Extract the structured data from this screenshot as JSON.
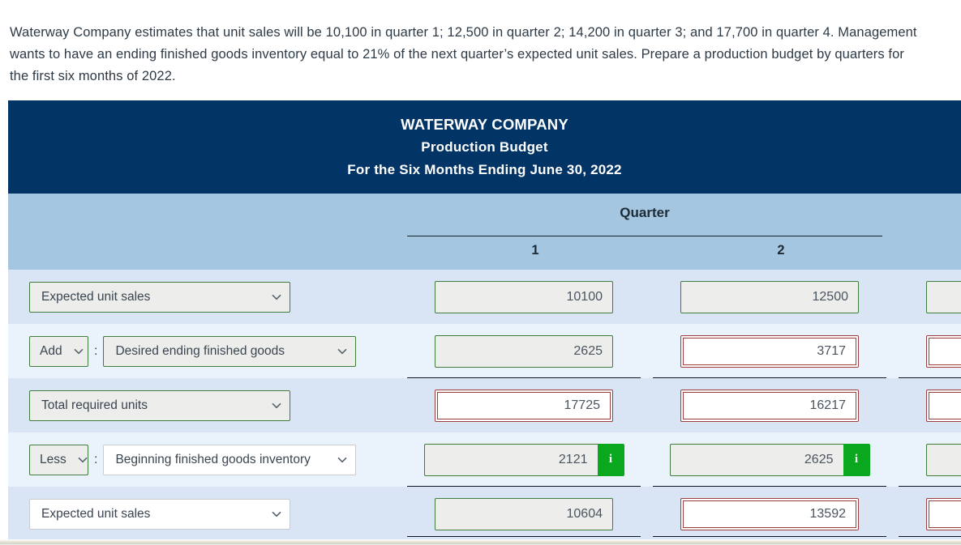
{
  "problem": {
    "text": "Waterway Company estimates that unit sales will be 10,100 in quarter 1; 12,500 in quarter 2; 14,200 in quarter 3; and 17,700 in quarter 4. Management wants to have an ending finished goods inventory equal to 21% of the next quarter’s expected unit sales. Prepare a production budget by quarters for the first six months of 2022."
  },
  "statement_header": {
    "company": "WATERWAY COMPANY",
    "report": "Production Budget",
    "period": "For the Six Months Ending June 30, 2022"
  },
  "column_group": {
    "label": "Quarter",
    "columns": [
      "1",
      "2"
    ]
  },
  "rows": [
    {
      "prefix": null,
      "prefix_colon": null,
      "account": "Expected unit sales",
      "account_style": "filled",
      "values": [
        {
          "value": "10100",
          "state": "filled",
          "info": false
        },
        {
          "value": "12500",
          "state": "filled",
          "info": false
        },
        {
          "value": "",
          "state": "filled",
          "info": false
        }
      ],
      "rule": "none"
    },
    {
      "prefix": "Add",
      "prefix_colon": ":",
      "account": "Desired ending finished goods",
      "account_style": "filled",
      "values": [
        {
          "value": "2625",
          "state": "filled",
          "info": false
        },
        {
          "value": "3717",
          "state": "wrong",
          "info": false
        },
        {
          "value": "",
          "state": "wrong",
          "info": false
        }
      ],
      "rule": "single"
    },
    {
      "prefix": null,
      "prefix_colon": null,
      "account": "Total required units",
      "account_style": "filled",
      "values": [
        {
          "value": "17725",
          "state": "wrong",
          "info": false
        },
        {
          "value": "16217",
          "state": "wrong",
          "info": false
        },
        {
          "value": "",
          "state": "wrong",
          "info": false
        }
      ],
      "rule": "none"
    },
    {
      "prefix": "Less",
      "prefix_colon": ":",
      "account": "Beginning finished goods inventory",
      "account_style": "white",
      "values": [
        {
          "value": "2121",
          "state": "filled",
          "info": true
        },
        {
          "value": "2625",
          "state": "filled",
          "info": true
        },
        {
          "value": "",
          "state": "filled",
          "info": false
        }
      ],
      "rule": "single"
    },
    {
      "prefix": null,
      "prefix_colon": null,
      "account": "Expected unit sales",
      "account_style": "white",
      "values": [
        {
          "value": "10604",
          "state": "filled",
          "info": false
        },
        {
          "value": "13592",
          "state": "wrong",
          "info": false
        },
        {
          "value": "",
          "state": "wrong",
          "info": false
        }
      ],
      "rule": "double"
    }
  ],
  "icons": {
    "chevron": "chevron-down-icon",
    "info": "i"
  },
  "colors": {
    "header_navy": "#023465",
    "quarter_band": "#a4c6e0",
    "row_odd": "#d9e5f5",
    "row_even": "#eaf2fc",
    "valid_border": "#3f7d3f",
    "error_border": "#9e3d3d",
    "info_green": "#0aa81e"
  }
}
